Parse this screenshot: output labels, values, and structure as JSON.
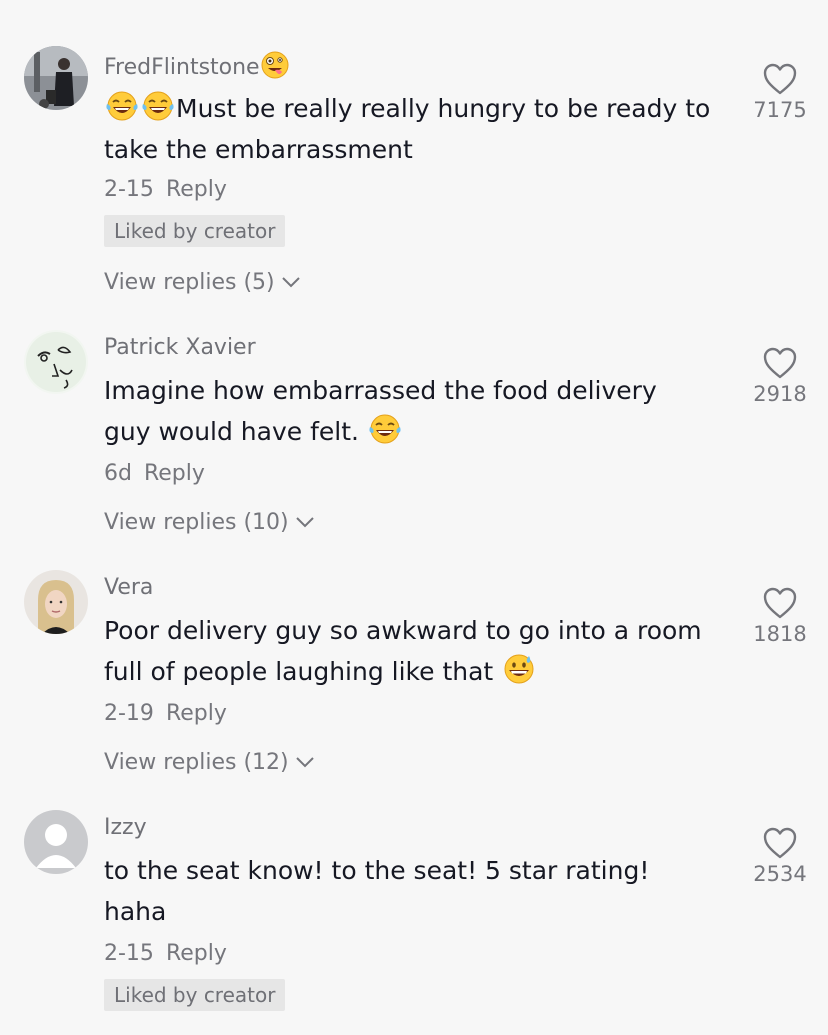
{
  "comments": [
    {
      "username": "FredFlintstone",
      "username_emoji": "zany-face",
      "text_prefix_emojis": [
        "tears-of-joy",
        "tears-of-joy"
      ],
      "text": "Must be really really hungry to be ready to take the embarrassment",
      "date": "2-15",
      "reply_label": "Reply",
      "liked_by_creator": "Liked by creator",
      "view_replies": "View replies (5)",
      "likes": "7175"
    },
    {
      "username": "Patrick Xavier",
      "text": "Imagine how embarrassed the food delivery guy would have felt.",
      "text_suffix_emoji": "tears-of-joy",
      "date": "6d",
      "reply_label": "Reply",
      "view_replies": "View replies (10)",
      "likes": "2918"
    },
    {
      "username": "Vera",
      "text": "Poor delivery guy so awkward to go into a room full of people laughing like that",
      "text_suffix_emoji": "grinning-sweat",
      "date": "2-19",
      "reply_label": "Reply",
      "view_replies": "View replies (12)",
      "likes": "1818"
    },
    {
      "username": "Izzy",
      "text": "to the seat know! to the seat! 5 star rating! haha",
      "date": "2-15",
      "reply_label": "Reply",
      "liked_by_creator": "Liked by creator",
      "likes": "2534"
    }
  ],
  "colors": {
    "background": "#f7f7f7",
    "text": "#161823",
    "secondary_text": "#75767c",
    "badge_bg": "#e6e6e6"
  }
}
